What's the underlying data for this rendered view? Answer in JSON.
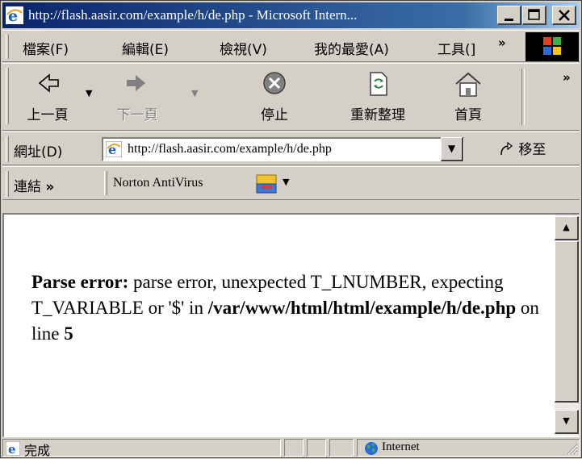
{
  "window": {
    "title": "http://flash.aasir.com/example/h/de.php - Microsoft Intern..."
  },
  "menu": {
    "items": [
      "檔案(F)",
      "編輯(E)",
      "檢視(V)",
      "我的最愛(A)",
      "工具(]"
    ],
    "more": "»"
  },
  "toolbar": {
    "back": "上一頁",
    "forward": "下一頁",
    "stop": "停止",
    "refresh": "重新整理",
    "home": "首頁",
    "more": "»"
  },
  "address": {
    "label": "網址(D)",
    "url": "http://flash.aasir.com/example/h/de.php",
    "go": "移至"
  },
  "links": {
    "label": "連結",
    "more": "»",
    "norton": "Norton AntiVirus"
  },
  "content": {
    "err_label": "Parse error:",
    "err_msg": " parse error, unexpected T_LNUMBER, expecting T_VARIABLE or '$' in ",
    "err_path": "/var/www/html/html/example/h/de.php",
    "err_on": " on line ",
    "err_line": "5"
  },
  "status": {
    "text": "完成",
    "zone": "Internet"
  },
  "colors": {
    "titlebar_start": "#0a246a",
    "titlebar_end": "#a6caf0",
    "chrome": "#d4d0c8"
  }
}
